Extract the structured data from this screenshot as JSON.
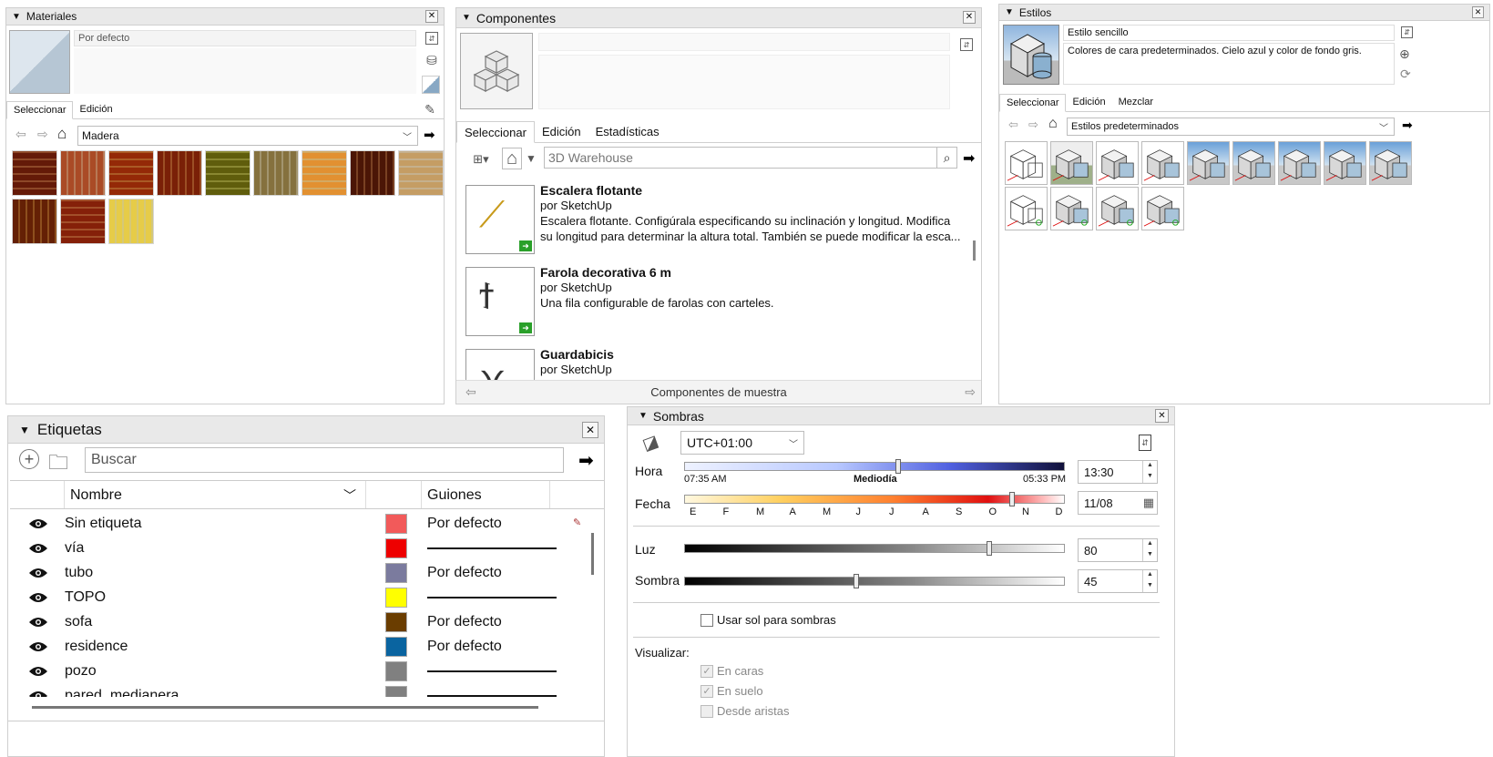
{
  "materiales": {
    "title": "Materiales",
    "name_value": "Por defecto",
    "tabs": [
      "Seleccionar",
      "Edición"
    ],
    "library": "Madera",
    "swatches": [
      "#a0522d",
      "#d08a62",
      "#c2662a",
      "#b05a2a",
      "#9c9a38",
      "#b8aa7e",
      "#f0c070",
      "#8a4a28",
      "#e0c8a0",
      "#a05a22",
      "#b85a30",
      "#f2e488"
    ]
  },
  "componentes": {
    "title": "Componentes",
    "tabs": [
      "Seleccionar",
      "Edición",
      "Estadísticas"
    ],
    "search_placeholder": "3D Warehouse",
    "items": [
      {
        "name": "Escalera flotante",
        "author": "por SketchUp",
        "desc1": "Escalera flotante. Configúrala especificando su inclinación y longitud.  Modifica",
        "desc2": "su longitud para determinar la altura total.  También se puede modificar la esca..."
      },
      {
        "name": "Farola decorativa 6 m",
        "author": "por SketchUp",
        "desc1": "Una fila configurable de farolas con carteles.",
        "desc2": ""
      },
      {
        "name": "Guardabicis",
        "author": "por SketchUp",
        "desc1": "",
        "desc2": ""
      }
    ],
    "footer": "Componentes de muestra"
  },
  "estilos": {
    "title": "Estilos",
    "name_value": "Estilo sencillo",
    "desc": "Colores de cara predeterminados. Cielo azul y color de fondo gris.",
    "tabs": [
      "Seleccionar",
      "Edición",
      "Mezclar"
    ],
    "library": "Estilos predeterminados",
    "thumb_count": 13
  },
  "etiquetas": {
    "title": "Etiquetas",
    "search_placeholder": "Buscar",
    "col_name": "Nombre",
    "col_dash": "Guiones",
    "rows": [
      {
        "name": "Sin etiqueta",
        "color": "#f25a5a",
        "dash": "Por defecto"
      },
      {
        "name": "vía",
        "color": "#ee0000",
        "dash": ""
      },
      {
        "name": "tubo",
        "color": "#7b7b9e",
        "dash": "Por defecto"
      },
      {
        "name": "TOPO",
        "color": "#ffff00",
        "dash": ""
      },
      {
        "name": "sofa",
        "color": "#6a3d00",
        "dash": "Por defecto"
      },
      {
        "name": "residence",
        "color": "#0a64a0",
        "dash": "Por defecto"
      },
      {
        "name": "pozo",
        "color": "#808080",
        "dash": ""
      },
      {
        "name": "pared_medianera",
        "color": "#808080",
        "dash": ""
      }
    ]
  },
  "sombras": {
    "title": "Sombras",
    "timezone": "UTC+01:00",
    "hora_label": "Hora",
    "hora_start": "07:35 AM",
    "hora_mid": "Mediodía",
    "hora_end": "05:33 PM",
    "hora_value": "13:30",
    "fecha_label": "Fecha",
    "months": [
      "E",
      "F",
      "M",
      "A",
      "M",
      "J",
      "J",
      "A",
      "S",
      "O",
      "N",
      "D"
    ],
    "fecha_value": "11/08",
    "luz_label": "Luz",
    "luz_value": "80",
    "sombra_label": "Sombra",
    "sombra_value": "45",
    "usar_sol": "Usar sol para sombras",
    "visualizar": "Visualizar:",
    "en_caras": "En caras",
    "en_suelo": "En suelo",
    "desde_aristas": "Desde aristas",
    "hora_fraction": 0.56,
    "fecha_fraction": 0.86,
    "luz_fraction": 0.8,
    "sombra_fraction": 0.45
  }
}
